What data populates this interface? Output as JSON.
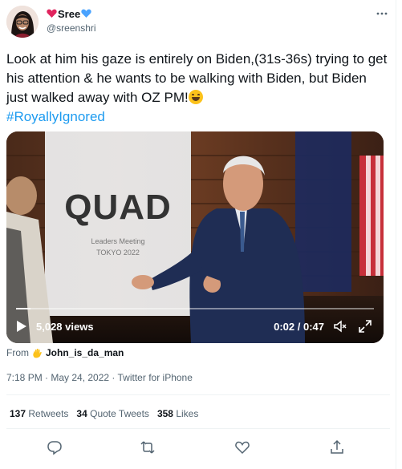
{
  "author": {
    "display_name": "Sree",
    "handle": "@sreenshri",
    "more_icon": "ellipsis-icon",
    "heart_left_color": "#e0245e",
    "heart_right_color": "#4aa3ff"
  },
  "tweet": {
    "text": "Look at him his gaze is entirely on Biden,(31s-36s) trying to get his attention & he wants to be walking with Biden, but Biden just walked away with OZ PM!",
    "hashtag": "#RoyallyIgnored",
    "hashtag_color": "#1d9bf0"
  },
  "video": {
    "banner_text": "QUAD",
    "banner_subtitle": "Leaders Meeting",
    "banner_location": "TOKYO 2022",
    "views": "5,028 views",
    "time": "0:02 / 0:47",
    "progress_fraction": 0.04
  },
  "source": {
    "prefix": "From",
    "name": "John_is_da_man"
  },
  "meta": {
    "text": "7:18 PM · May 24, 2022 · Twitter for iPhone"
  },
  "stats": {
    "retweets_count": "137",
    "retweets_label": "Retweets",
    "quotes_count": "34",
    "quotes_label": "Quote Tweets",
    "likes_count": "358",
    "likes_label": "Likes"
  },
  "actions": [
    "reply-icon",
    "retweet-icon",
    "like-icon",
    "share-icon"
  ]
}
